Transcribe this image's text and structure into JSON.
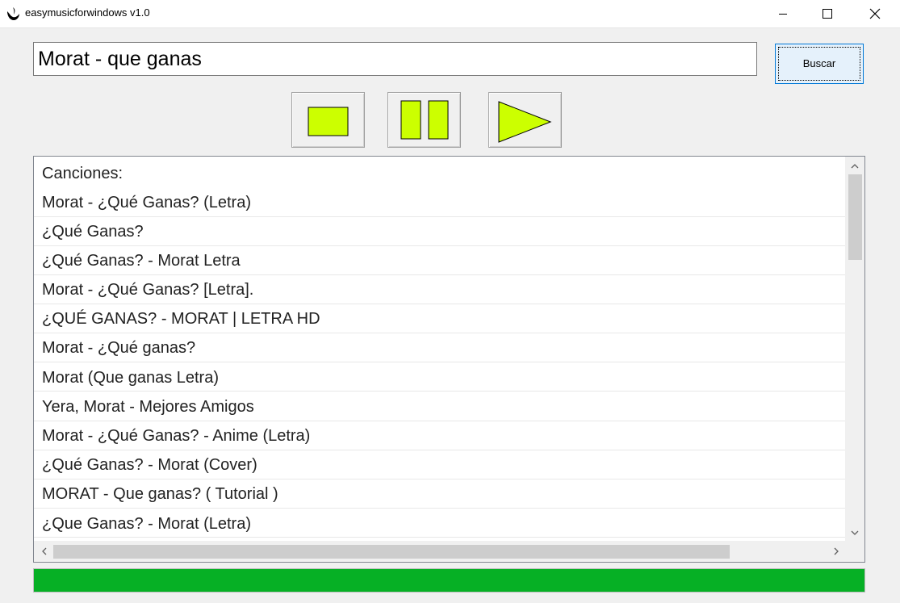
{
  "window": {
    "title": "easymusicforwindows v1.0"
  },
  "search": {
    "value": "Morat - que ganas",
    "button_label": "Buscar"
  },
  "controls": {
    "stop_icon": "stop-icon",
    "pause_icon": "pause-icon",
    "play_icon": "play-icon",
    "icon_color": "#ccff00"
  },
  "list": {
    "header": "Canciones:",
    "items": [
      "Morat - ¿Qué Ganas? (Letra)",
      "¿Qué Ganas?",
      "¿Qué Ganas? -  Morat Letra",
      "Morat - ¿Qué Ganas? [Letra].",
      "¿QUÉ GANAS? - MORAT | LETRA HD",
      "Morat - ¿Qué ganas?",
      "Morat (Que ganas Letra)",
      "Yera, Morat - Mejores Amigos",
      "Morat - ¿Qué Ganas? - Anime (Letra)",
      "¿Qué Ganas? - Morat (Cover)",
      "MORAT - Que ganas? ( Tutorial )",
      "¿Que Ganas? - Morat (Letra)"
    ]
  },
  "progress": {
    "percent": 100,
    "color": "#06b025"
  }
}
